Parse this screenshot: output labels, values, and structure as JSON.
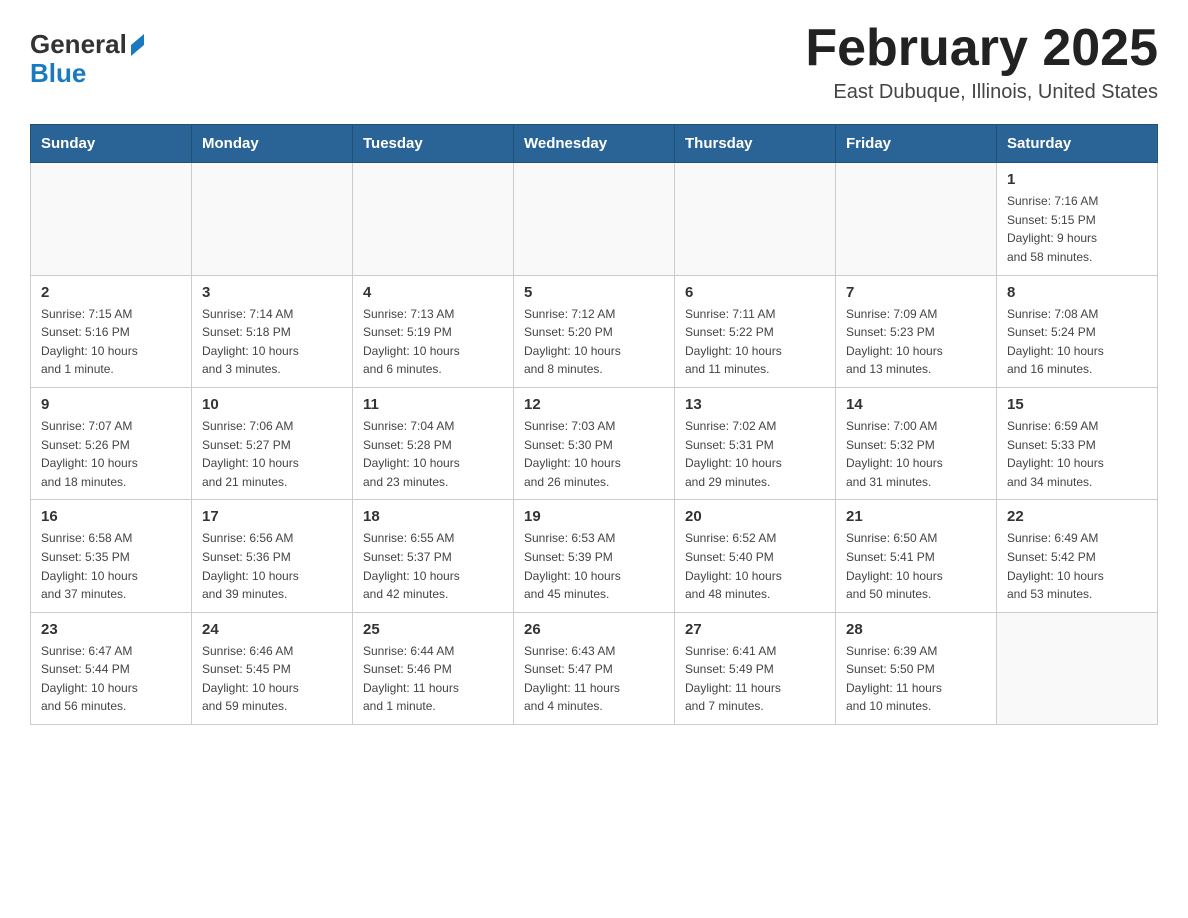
{
  "header": {
    "logo_general": "General",
    "logo_blue": "Blue",
    "title": "February 2025",
    "location": "East Dubuque, Illinois, United States"
  },
  "weekdays": [
    "Sunday",
    "Monday",
    "Tuesday",
    "Wednesday",
    "Thursday",
    "Friday",
    "Saturday"
  ],
  "weeks": [
    [
      {
        "day": "",
        "info": ""
      },
      {
        "day": "",
        "info": ""
      },
      {
        "day": "",
        "info": ""
      },
      {
        "day": "",
        "info": ""
      },
      {
        "day": "",
        "info": ""
      },
      {
        "day": "",
        "info": ""
      },
      {
        "day": "1",
        "info": "Sunrise: 7:16 AM\nSunset: 5:15 PM\nDaylight: 9 hours\nand 58 minutes."
      }
    ],
    [
      {
        "day": "2",
        "info": "Sunrise: 7:15 AM\nSunset: 5:16 PM\nDaylight: 10 hours\nand 1 minute."
      },
      {
        "day": "3",
        "info": "Sunrise: 7:14 AM\nSunset: 5:18 PM\nDaylight: 10 hours\nand 3 minutes."
      },
      {
        "day": "4",
        "info": "Sunrise: 7:13 AM\nSunset: 5:19 PM\nDaylight: 10 hours\nand 6 minutes."
      },
      {
        "day": "5",
        "info": "Sunrise: 7:12 AM\nSunset: 5:20 PM\nDaylight: 10 hours\nand 8 minutes."
      },
      {
        "day": "6",
        "info": "Sunrise: 7:11 AM\nSunset: 5:22 PM\nDaylight: 10 hours\nand 11 minutes."
      },
      {
        "day": "7",
        "info": "Sunrise: 7:09 AM\nSunset: 5:23 PM\nDaylight: 10 hours\nand 13 minutes."
      },
      {
        "day": "8",
        "info": "Sunrise: 7:08 AM\nSunset: 5:24 PM\nDaylight: 10 hours\nand 16 minutes."
      }
    ],
    [
      {
        "day": "9",
        "info": "Sunrise: 7:07 AM\nSunset: 5:26 PM\nDaylight: 10 hours\nand 18 minutes."
      },
      {
        "day": "10",
        "info": "Sunrise: 7:06 AM\nSunset: 5:27 PM\nDaylight: 10 hours\nand 21 minutes."
      },
      {
        "day": "11",
        "info": "Sunrise: 7:04 AM\nSunset: 5:28 PM\nDaylight: 10 hours\nand 23 minutes."
      },
      {
        "day": "12",
        "info": "Sunrise: 7:03 AM\nSunset: 5:30 PM\nDaylight: 10 hours\nand 26 minutes."
      },
      {
        "day": "13",
        "info": "Sunrise: 7:02 AM\nSunset: 5:31 PM\nDaylight: 10 hours\nand 29 minutes."
      },
      {
        "day": "14",
        "info": "Sunrise: 7:00 AM\nSunset: 5:32 PM\nDaylight: 10 hours\nand 31 minutes."
      },
      {
        "day": "15",
        "info": "Sunrise: 6:59 AM\nSunset: 5:33 PM\nDaylight: 10 hours\nand 34 minutes."
      }
    ],
    [
      {
        "day": "16",
        "info": "Sunrise: 6:58 AM\nSunset: 5:35 PM\nDaylight: 10 hours\nand 37 minutes."
      },
      {
        "day": "17",
        "info": "Sunrise: 6:56 AM\nSunset: 5:36 PM\nDaylight: 10 hours\nand 39 minutes."
      },
      {
        "day": "18",
        "info": "Sunrise: 6:55 AM\nSunset: 5:37 PM\nDaylight: 10 hours\nand 42 minutes."
      },
      {
        "day": "19",
        "info": "Sunrise: 6:53 AM\nSunset: 5:39 PM\nDaylight: 10 hours\nand 45 minutes."
      },
      {
        "day": "20",
        "info": "Sunrise: 6:52 AM\nSunset: 5:40 PM\nDaylight: 10 hours\nand 48 minutes."
      },
      {
        "day": "21",
        "info": "Sunrise: 6:50 AM\nSunset: 5:41 PM\nDaylight: 10 hours\nand 50 minutes."
      },
      {
        "day": "22",
        "info": "Sunrise: 6:49 AM\nSunset: 5:42 PM\nDaylight: 10 hours\nand 53 minutes."
      }
    ],
    [
      {
        "day": "23",
        "info": "Sunrise: 6:47 AM\nSunset: 5:44 PM\nDaylight: 10 hours\nand 56 minutes."
      },
      {
        "day": "24",
        "info": "Sunrise: 6:46 AM\nSunset: 5:45 PM\nDaylight: 10 hours\nand 59 minutes."
      },
      {
        "day": "25",
        "info": "Sunrise: 6:44 AM\nSunset: 5:46 PM\nDaylight: 11 hours\nand 1 minute."
      },
      {
        "day": "26",
        "info": "Sunrise: 6:43 AM\nSunset: 5:47 PM\nDaylight: 11 hours\nand 4 minutes."
      },
      {
        "day": "27",
        "info": "Sunrise: 6:41 AM\nSunset: 5:49 PM\nDaylight: 11 hours\nand 7 minutes."
      },
      {
        "day": "28",
        "info": "Sunrise: 6:39 AM\nSunset: 5:50 PM\nDaylight: 11 hours\nand 10 minutes."
      },
      {
        "day": "",
        "info": ""
      }
    ]
  ]
}
